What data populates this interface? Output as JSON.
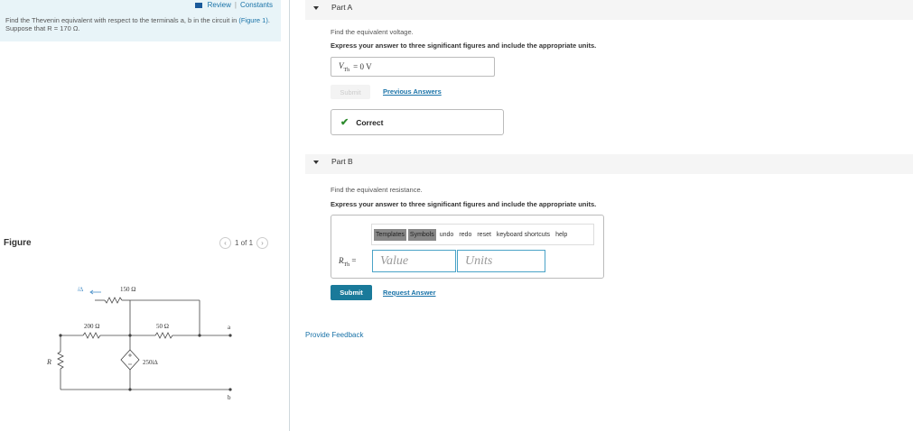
{
  "problem": {
    "review_label": "Review",
    "constants_label": "Constants",
    "separator": "|",
    "text_before": "Find the Thevenin equivalent with respect to the terminals a, b in the circuit in ",
    "figure_link": "(Figure 1)",
    "text_after": ". Suppose that R = 170 Ω."
  },
  "figure": {
    "label": "Figure",
    "pager": "1 of 1",
    "prev_glyph": "‹",
    "next_glyph": "›",
    "circuit": {
      "current_label": "i∆",
      "r_top": "150 Ω",
      "r_left": "200 Ω",
      "r_mid": "50 Ω",
      "r_var": "R",
      "source": "250i∆",
      "terminal_a": "a",
      "terminal_b": "b"
    }
  },
  "partA": {
    "title": "Part A",
    "question": "Find the equivalent voltage.",
    "instruction": "Express your answer to three significant figures and include the appropriate units.",
    "answer_label": "V",
    "answer_sub": "Th",
    "answer_value": "=  0 V",
    "submit_label": "Submit",
    "previous_answers": "Previous Answers",
    "correct_label": "Correct",
    "check_glyph": "✔"
  },
  "partB": {
    "title": "Part B",
    "question": "Find the equivalent resistance.",
    "instruction": "Express your answer to three significant figures and include the appropriate units.",
    "toolbar": {
      "templates": "Templates",
      "symbols": "Symbols",
      "undo": "undo",
      "redo": "redo",
      "reset": "reset",
      "shortcuts": "keyboard shortcuts",
      "help": "help"
    },
    "label": "R",
    "label_sub": "Th",
    "equals": "=",
    "value_placeholder": "Value",
    "units_placeholder": "Units",
    "submit_label": "Submit",
    "request_answer": "Request Answer"
  },
  "feedback_label": "Provide Feedback",
  "colors": {
    "accent": "#1a7a9a",
    "link": "#1a73a8",
    "correct": "#2e8b2e"
  }
}
